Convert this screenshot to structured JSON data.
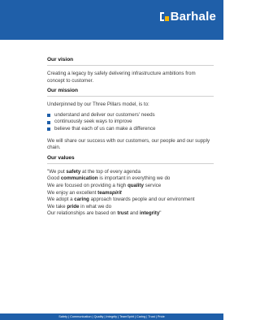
{
  "brand": {
    "name": "Barhale",
    "color": "#1f5fa9",
    "mark": "barhale-logo-mark"
  },
  "sections": {
    "vision": {
      "heading": "Our vision",
      "text": "Creating a legacy by safely delivering infrastructure ambitions from concept to customer."
    },
    "mission": {
      "heading": "Our mission",
      "intro": "Underpinned by our Three Pillars model, is to:",
      "bullets": [
        "understand and deliver our customers' needs",
        "continuously seek ways to improve",
        "believe that each of us can make a difference"
      ],
      "closing": "We will share our success with our customers, our people and our supply chain."
    },
    "values": {
      "heading": "Our values",
      "lines": [
        [
          {
            "t": "\"We put "
          },
          {
            "t": "safety",
            "b": true
          },
          {
            "t": " at the top of every agenda"
          }
        ],
        [
          {
            "t": "Good "
          },
          {
            "t": "communication",
            "b": true
          },
          {
            "t": " is important in everything we do"
          }
        ],
        [
          {
            "t": "We are focused on providing a high "
          },
          {
            "t": "quality",
            "b": true
          },
          {
            "t": " service"
          }
        ],
        [
          {
            "t": "We enjoy an excellent "
          },
          {
            "t": "team",
            "b": true
          },
          {
            "t": "spirit",
            "bi": true
          }
        ],
        [
          {
            "t": "We adopt a "
          },
          {
            "t": "caring",
            "b": true
          },
          {
            "t": " approach towards people and our environment"
          }
        ],
        [
          {
            "t": "We take "
          },
          {
            "t": "pride",
            "b": true
          },
          {
            "t": " in what we do"
          }
        ],
        [
          {
            "t": "Our relationships are based on "
          },
          {
            "t": "trust",
            "b": true
          },
          {
            "t": " and "
          },
          {
            "t": "integrity",
            "b": true
          },
          {
            "t": "\""
          }
        ]
      ]
    }
  },
  "footer": {
    "text": "Safety | Communication | Quality | Integrity | TeamSpirit | Caring | Trust | Pride"
  }
}
